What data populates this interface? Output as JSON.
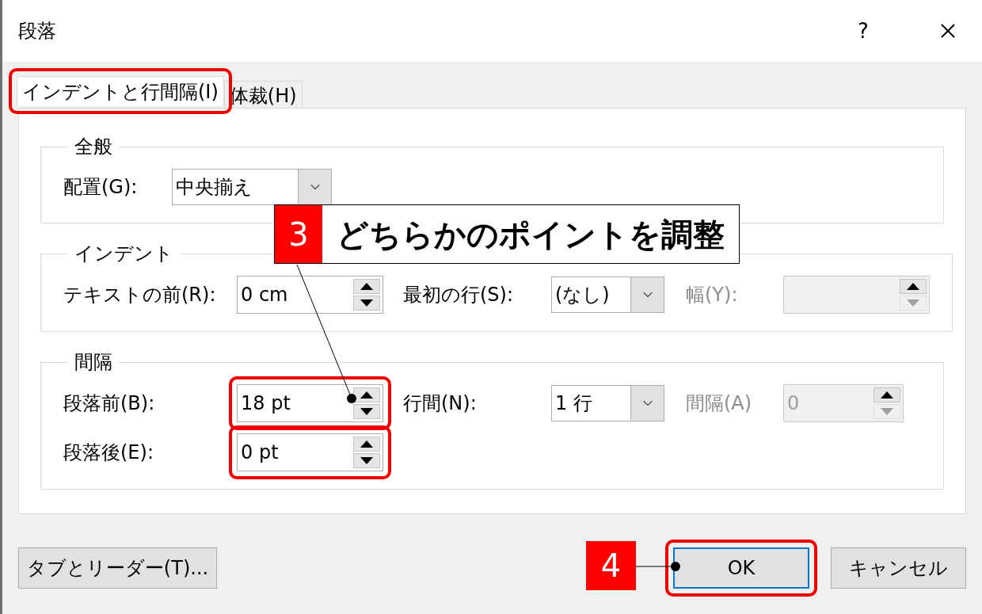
{
  "window": {
    "title": "段落",
    "help": "?"
  },
  "tabs": [
    {
      "label": "インデントと行間隔(I)",
      "selected": true,
      "highlighted": true
    },
    {
      "label": "体裁(H)",
      "selected": false,
      "highlighted": false
    }
  ],
  "groups": [
    {
      "title": "全般",
      "rows": [
        [
          {
            "kind": "dropdown",
            "label": "配置(G):",
            "value": "中央揃え",
            "disabled": false,
            "highlighted": false
          }
        ]
      ]
    },
    {
      "title": "インデント",
      "rows": [
        [
          {
            "kind": "spin",
            "label": "テキストの前(R):",
            "value": "0 cm",
            "disabled": false,
            "highlighted": false
          },
          {
            "kind": "dropdown",
            "label": "最初の行(S):",
            "value": "(なし)",
            "disabled": false,
            "highlighted": false
          },
          {
            "kind": "spin",
            "label": "幅(Y):",
            "disabled": true,
            "highlighted": false
          }
        ]
      ]
    },
    {
      "title": "間隔",
      "rows": [
        [
          {
            "kind": "spin",
            "label": "段落前(B):",
            "value": "18 pt",
            "disabled": false,
            "highlighted": true
          },
          {
            "kind": "dropdown",
            "label": "行間(N):",
            "value": "1 行",
            "disabled": false,
            "highlighted": false
          },
          {
            "kind": "spin",
            "label": "間隔(A)",
            "value": "0",
            "disabled": true,
            "highlighted": false
          }
        ],
        [
          {
            "kind": "spin",
            "label": "段落後(E):",
            "value": "0 pt",
            "disabled": false,
            "highlighted": true
          }
        ]
      ]
    }
  ],
  "buttons": [
    {
      "label": "タブとリーダー(T)...",
      "default": false,
      "highlighted": false
    },
    {
      "label": "OK",
      "default": true,
      "highlighted": true
    },
    {
      "label": "キャンセル",
      "default": false,
      "highlighted": false
    }
  ],
  "annotations": [
    {
      "kind": "callout",
      "number": "3",
      "text": "どちらかのポイントを調整"
    },
    {
      "kind": "step",
      "number": "4"
    }
  ]
}
